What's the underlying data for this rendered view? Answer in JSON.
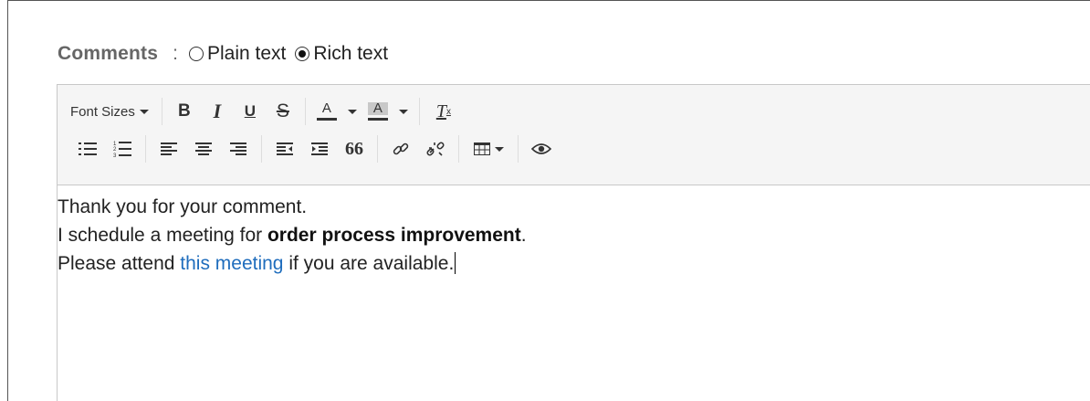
{
  "format": {
    "label": "Comments",
    "separator": ":",
    "options": [
      {
        "label": "Plain text",
        "selected": false
      },
      {
        "label": "Rich text",
        "selected": true
      }
    ]
  },
  "toolbar": {
    "font_sizes_label": "Font Sizes",
    "bold_label": "B",
    "italic_label": "I",
    "underline_label": "U",
    "strike_label": "S",
    "text_color_label": "A",
    "bg_color_label": "A",
    "clear_label": "T",
    "clear_sub": "x",
    "icons_row2": [
      "bullet-list-icon",
      "numbered-list-icon",
      "align-left-icon",
      "align-center-icon",
      "align-right-icon",
      "outdent-icon",
      "indent-icon",
      "blockquote-icon",
      "link-icon",
      "unlink-icon",
      "table-icon",
      "preview-icon"
    ],
    "quote_glyph": "66"
  },
  "editor": {
    "line1": "Thank you for your comment.",
    "line2_prefix": "I schedule a meeting for ",
    "line2_bold": "order process improvement",
    "line2_suffix": ".",
    "line3_prefix": "Please attend ",
    "line3_link": "this meeting",
    "line3_suffix": " if you are available."
  },
  "colors": {
    "link": "#1f6dbd",
    "toolbar_bg": "#f5f5f5"
  }
}
